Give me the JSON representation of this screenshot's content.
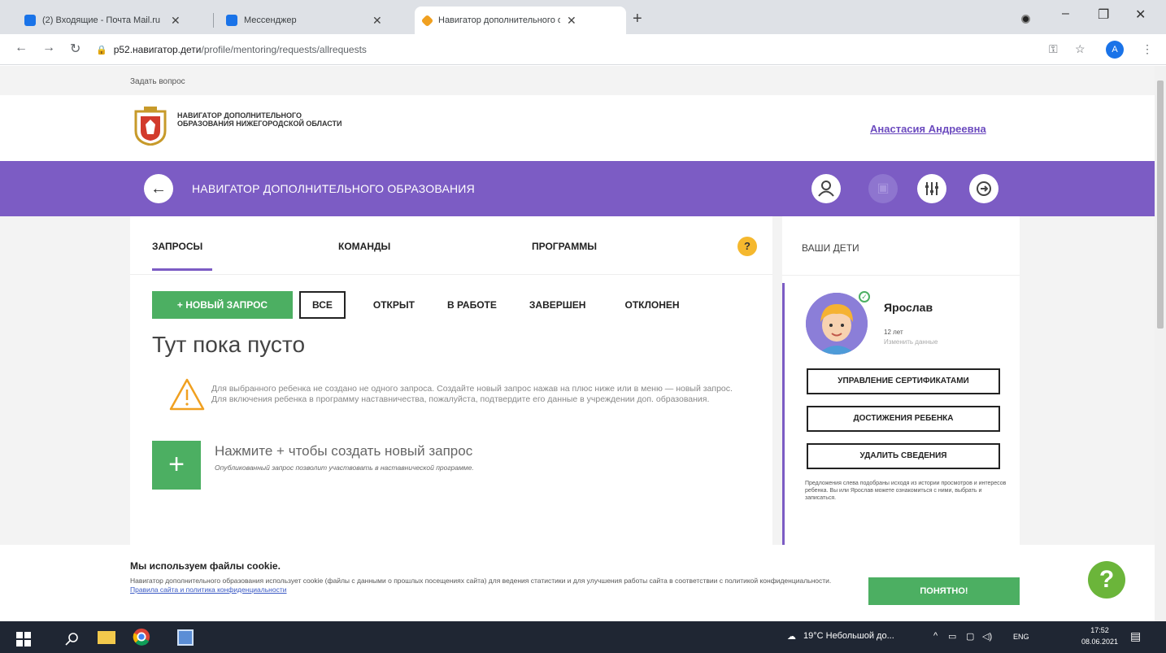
{
  "browser": {
    "tabs": [
      {
        "title": "(2) Входящие - Почта Mail.ru",
        "active": false
      },
      {
        "title": "Мессенджер",
        "active": false
      },
      {
        "title": "Навигатор дополнительного о",
        "active": true
      }
    ],
    "url_host": "p52.навигатор.дети",
    "url_path": "/profile/mentoring/requests/allrequests",
    "profile_initial": "A"
  },
  "site": {
    "ask_link": "Задать вопрос",
    "logo_text": "НАВИГАТОР ДОПОЛНИТЕЛЬНОГО ОБРАЗОВАНИЯ НИЖЕГОРОДСКОЙ ОБЛАСТИ",
    "user_name": "Анастасия Андреевна",
    "bar_title": "НАВИГАТОР ДОПОЛНИТЕЛЬНОГО ОБРАЗОВАНИЯ",
    "colors": {
      "accent": "#7c5cc4",
      "green": "#4caf62",
      "warn": "#f5b82e"
    }
  },
  "main": {
    "tabs": [
      {
        "label": "ЗАПРОСЫ",
        "active": true
      },
      {
        "label": "КОМАНДЫ",
        "active": false
      },
      {
        "label": "ПРОГРАММЫ",
        "active": false
      }
    ],
    "help_label": "?",
    "new_request": "+ НОВЫЙ ЗАПРОС",
    "filters": [
      "ВСЕ",
      "ОТКРЫТ",
      "В РАБОТЕ",
      "ЗАВЕРШЕН",
      "ОТКЛОНЕН"
    ],
    "empty_title": "Тут пока пусто",
    "warning_text": "Для выбранного ребенка не создано не одного запроса. Создайте новый запрос нажав на плюс ниже или в меню — новый запрос. Для включения ребенка в программу наставничества, пожалуйста, подтвердите его данные в учреждении доп. образования.",
    "create_title": "Нажмите + чтобы создать новый запрос",
    "create_subtitle": "Опубликованный запрос позволит участвовать в наставнической программе."
  },
  "sidebar": {
    "title": "ВАШИ ДЕТИ",
    "child": {
      "name": "Ярослав",
      "age": "12 лет",
      "edit": "Изменить данные"
    },
    "buttons": [
      "УПРАВЛЕНИЕ СЕРТИФИКАТАМИ",
      "ДОСТИЖЕНИЯ РЕБЕНКА",
      "УДАЛИТЬ СВЕДЕНИЯ"
    ],
    "note": "Предложения слева подобраны исходя из истории просмотров и интересов ребенка. Вы или Ярослав можете ознакомиться с ними, выбрать и записаться."
  },
  "cookie": {
    "title": "Мы используем файлы cookie.",
    "text": "Навигатор дополнительного образования использует cookie (файлы с данными о прошлых посещениях сайта) для ведения статистики и для улучшения работы сайта в соответствии с политикой конфиденциальности.",
    "link": "Правила сайта и политика конфиденциальности",
    "button": "ПОНЯТНО!",
    "help": "?"
  },
  "taskbar": {
    "weather": "19°C Небольшой до...",
    "lang": "ENG",
    "time": "17:52",
    "date": "08.06.2021"
  }
}
